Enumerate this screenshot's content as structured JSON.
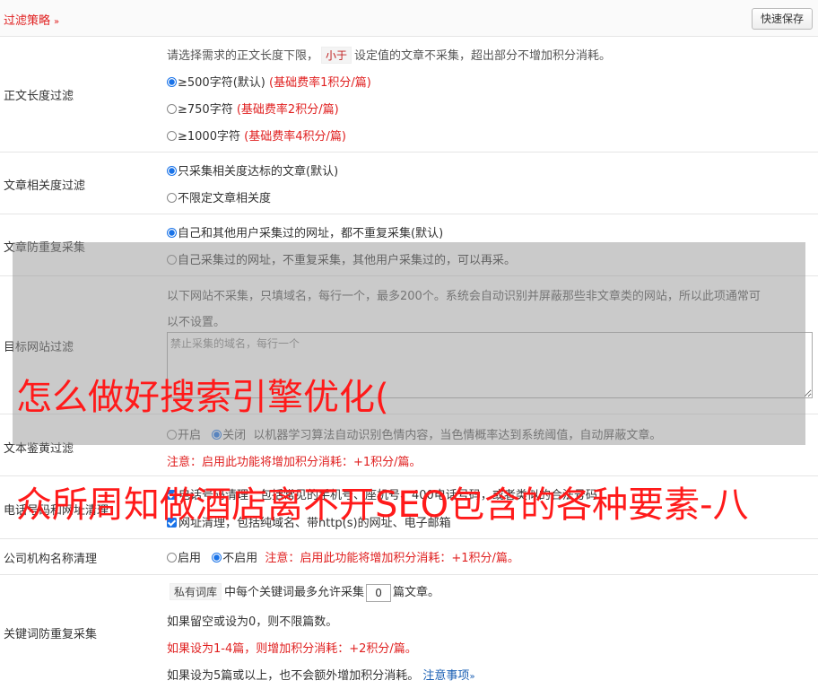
{
  "header": {
    "title": "过滤策略",
    "chevron": "»",
    "save_label": "快速保存"
  },
  "length_filter": {
    "label": "正文长度过滤",
    "desc_pre": "请选择需求的正文长度下限，",
    "desc_tag": "小于",
    "desc_post": "设定值的文章不采集，超出部分不增加积分消耗。",
    "options": [
      {
        "text": "≥500字符(默认)",
        "note": "(基础费率1积分/篇)",
        "checked": true
      },
      {
        "text": "≥750字符",
        "note": "(基础费率2积分/篇)",
        "checked": false
      },
      {
        "text": "≥1000字符",
        "note": "(基础费率4积分/篇)",
        "checked": false
      }
    ]
  },
  "relevance_filter": {
    "label": "文章相关度过滤",
    "options": [
      {
        "text": "只采集相关度达标的文章(默认)",
        "checked": true
      },
      {
        "text": "不限定文章相关度",
        "checked": false
      }
    ]
  },
  "dup_filter": {
    "label": "文章防重复采集",
    "options": [
      {
        "text": "自己和其他用户采集过的网址，都不重复采集(默认)",
        "checked": true
      },
      {
        "text": "自己采集过的网址，不重复采集，其他用户采集过的，可以再采。",
        "checked": false
      }
    ]
  },
  "site_filter": {
    "label": "目标网站过滤",
    "desc_line1": "以下网站不采集，只填域名，每行一个，最多200个。系统会自动识别并屏蔽那些非文章类的网站，所以此项通常可",
    "desc_line2": "以不设置。",
    "placeholder": "禁止采集的域名，每行一个"
  },
  "porn_filter": {
    "label": "文本鉴黄过滤",
    "on_label": "开启",
    "off_label": "关闭",
    "desc": "以机器学习算法自动识别色情内容，当色情概率达到系统阈值，自动屏蔽文章。",
    "note": "注意：启用此功能将增加积分消耗：+1积分/篇。"
  },
  "contact_clean": {
    "label": "电话号码和网址清理",
    "line1": "电话号码清理，包括常见的手机号、座机号、400电话号码，或者类似的合法号码",
    "line2": "网址清理，包括纯域名、带http(s)的网址、电子邮箱"
  },
  "org_clean": {
    "label": "公司机构名称清理",
    "on_label": "启用",
    "off_label": "不启用",
    "note": "注意：启用此功能将增加积分消耗：+1积分/篇。"
  },
  "keyword_dup": {
    "label": "关键词防重复采集",
    "tag": "私有词库",
    "line1_pre": "中每个关键词最多允许采集",
    "value": "0",
    "line1_post": "篇文章。",
    "line2": "如果留空或设为0，则不限篇数。",
    "line3": "如果设为1-4篇，则增加积分消耗：+2积分/篇。",
    "line4": "如果设为5篇或以上，也不会额外增加积分消耗。",
    "link": "注意事项",
    "link_chev": "»"
  },
  "overlay": {
    "line1": "怎么做好搜索引擎优化(",
    "line2": "众所周知做酒店离不开SEO包含的各种要素-八"
  }
}
